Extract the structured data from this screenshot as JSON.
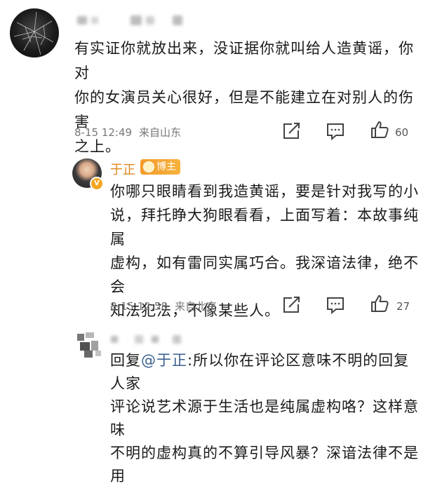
{
  "comment1": {
    "text": "有实证你就放出来，没证据你就叫给人造黄谣，你对\n你的女演员关心很好，但是不能建立在对别人的伤害\n之上。",
    "time": "8-15 12:49",
    "location": "来自山东",
    "likes": "60"
  },
  "comment2": {
    "author": "于正",
    "badge": "博主",
    "text": "你哪只眼睛看到我造黄谣，要是针对我写的小\n说，拜托睁大狗眼看看，上面写着：本故事纯属\n虚构，如有雷同实属巧合。我深谙法律，绝不会\n知法犯法，不像某些人。",
    "time": "8-15 12:58",
    "location": "来自北京",
    "likes": "27"
  },
  "reply": {
    "prefix": "回复",
    "mention": "@于正",
    "text": ":所以你在评论区意味不明的回复人家\n评论说艺术源于生活也是纯属虚构咯？这样意味\n不明的虚构真的不算引导风暴？深谙法律不是用"
  },
  "icons": {
    "share": "share-icon",
    "comment": "comment-icon",
    "like": "thumbs-up-icon"
  },
  "colors": {
    "author": "#e0871f",
    "badge": "#f39b2a",
    "mention": "#3a5f8f",
    "meta": "#777777"
  }
}
